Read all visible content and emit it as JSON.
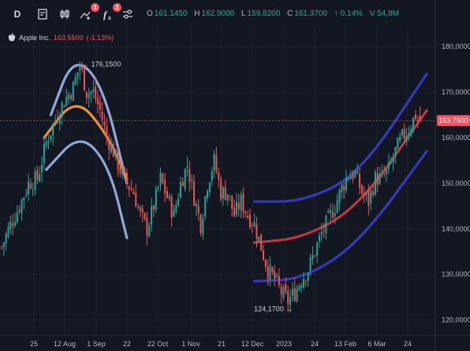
{
  "toolbar": {
    "interval": "D",
    "badge_a": "1",
    "badge_b": "2"
  },
  "ohlc": {
    "o_label": "O",
    "o": "161.1450",
    "h_label": "H",
    "h": "162.9000",
    "l_label": "L",
    "l": "159.8200",
    "c_label": "C",
    "c": "161.3700",
    "change": "↑ 0.14%",
    "volume": "V 54,8M"
  },
  "legend": {
    "name": "Apple Inc.",
    "price": "163.5500",
    "change": "(-1.13%)"
  },
  "colors": {
    "background": "#131722",
    "up": "#26a69a",
    "down": "#ef5350",
    "price_line": "#f7525f",
    "arc_outer": "#8fa8d8",
    "arc_mid": "#e8923a",
    "band_outer": "#3838b8",
    "band_mid": "#c0353f"
  },
  "chart_data": {
    "type": "candlestick",
    "y_ticks": [
      "180,0000",
      "170,0000",
      "160,0000",
      "150,0000",
      "140,0000",
      "130,0000",
      "120,0000"
    ],
    "y_range": [
      117,
      184
    ],
    "x_ticks": [
      "25",
      "12 Aug",
      "1 Sep",
      "22",
      "22 Oct",
      "1 Nov",
      "21",
      "12 Dec",
      "2023",
      "24",
      "13 Feb",
      "6 Mar",
      "24"
    ],
    "last_price_label": "163,7600",
    "last_price": 163.76,
    "annotations": [
      {
        "text": "176,1500",
        "value": 176.15
      },
      {
        "text": "124,1700 →",
        "value": 124.17
      }
    ],
    "price_path": [
      [
        0,
        136
      ],
      [
        4,
        141
      ],
      [
        8,
        145
      ],
      [
        12,
        150
      ],
      [
        16,
        151
      ],
      [
        20,
        159
      ],
      [
        24,
        164
      ],
      [
        28,
        168
      ],
      [
        32,
        171
      ],
      [
        35,
        176.2
      ],
      [
        38,
        170
      ],
      [
        41,
        170
      ],
      [
        44,
        166
      ],
      [
        47,
        160
      ],
      [
        50,
        157
      ],
      [
        53,
        153
      ],
      [
        56,
        150
      ],
      [
        59,
        148
      ],
      [
        62,
        143
      ],
      [
        65,
        140
      ],
      [
        68,
        145
      ],
      [
        71,
        151
      ],
      [
        74,
        147
      ],
      [
        77,
        143
      ],
      [
        80,
        150
      ],
      [
        83,
        154
      ],
      [
        86,
        147
      ],
      [
        89,
        141
      ],
      [
        92,
        150
      ],
      [
        95,
        155
      ],
      [
        98,
        148
      ],
      [
        101,
        148
      ],
      [
        104,
        143
      ],
      [
        107,
        146
      ],
      [
        110,
        143
      ],
      [
        113,
        141
      ],
      [
        116,
        136
      ],
      [
        119,
        131
      ],
      [
        122,
        129
      ],
      [
        125,
        126
      ],
      [
        128,
        124.2
      ],
      [
        131,
        126
      ],
      [
        134,
        129
      ],
      [
        137,
        131
      ],
      [
        140,
        135
      ],
      [
        143,
        139
      ],
      [
        146,
        142
      ],
      [
        149,
        145
      ],
      [
        152,
        149
      ],
      [
        155,
        152
      ],
      [
        158,
        152
      ],
      [
        161,
        148
      ],
      [
        164,
        146
      ],
      [
        167,
        151
      ],
      [
        170,
        151
      ],
      [
        173,
        153
      ],
      [
        176,
        157
      ],
      [
        179,
        160
      ],
      [
        182,
        162
      ],
      [
        185,
        165
      ],
      [
        187,
        163.8
      ]
    ],
    "overlays": [
      {
        "name": "arc-upper",
        "color": "#8fa8d8",
        "points": [
          [
            22,
            165
          ],
          [
            32,
            178
          ],
          [
            45,
            172
          ],
          [
            56,
            150
          ]
        ]
      },
      {
        "name": "arc-middle",
        "color": "#e8923a",
        "points": [
          [
            19,
            160
          ],
          [
            33,
            169
          ],
          [
            47,
            161
          ],
          [
            56,
            151
          ]
        ]
      },
      {
        "name": "arc-lower",
        "color": "#8fa8d8",
        "points": [
          [
            20,
            153
          ],
          [
            35,
            161
          ],
          [
            48,
            154
          ],
          [
            56,
            138
          ]
        ]
      },
      {
        "name": "band-upper",
        "color": "#3838b8",
        "points": [
          [
            113,
            146
          ],
          [
            135,
            146
          ],
          [
            160,
            152
          ],
          [
            190,
            174
          ]
        ]
      },
      {
        "name": "band-middle",
        "color": "#c0353f",
        "points": [
          [
            113,
            137
          ],
          [
            135,
            138
          ],
          [
            160,
            145
          ],
          [
            190,
            166
          ]
        ]
      },
      {
        "name": "band-lower",
        "color": "#3838b8",
        "points": [
          [
            113,
            128.5
          ],
          [
            135,
            129
          ],
          [
            160,
            137
          ],
          [
            190,
            157
          ]
        ]
      }
    ]
  }
}
